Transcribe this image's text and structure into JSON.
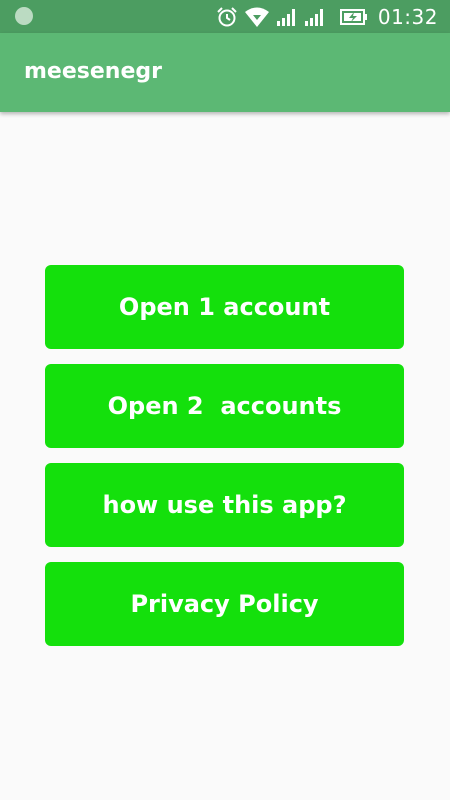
{
  "status_bar": {
    "time": "01:32",
    "icons": [
      "notification-dot-icon",
      "alarm-icon",
      "wifi-icon",
      "signal-icon",
      "signal-icon",
      "battery-charging-icon"
    ],
    "color": "#4c9d61"
  },
  "app_bar": {
    "title": "meesenegr",
    "color": "#5cb874"
  },
  "buttons": [
    {
      "label": "Open 1 account"
    },
    {
      "label": "Open 2  accounts"
    },
    {
      "label": "how use this app?"
    },
    {
      "label": "Privacy Policy"
    }
  ],
  "colors": {
    "button": "#14e00c",
    "background": "#fafafa"
  }
}
